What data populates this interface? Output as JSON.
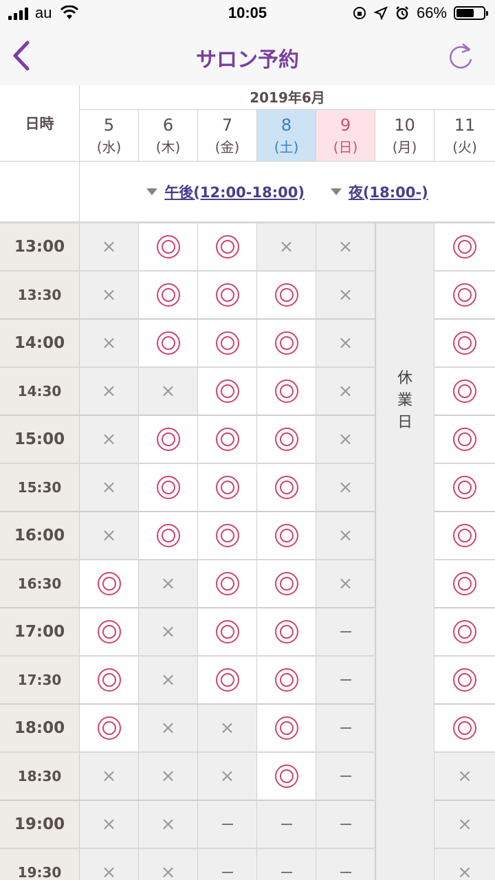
{
  "status": {
    "carrier": "au",
    "time": "10:05",
    "battery": "66%",
    "battery_level": 0.66
  },
  "nav": {
    "title": "サロン予約",
    "back_icon": "chevron-left-icon",
    "reload_icon": "reload-icon"
  },
  "header": {
    "datetime_label": "日時",
    "month": "2019年6月",
    "days": [
      {
        "num": "5",
        "dow": "(水)"
      },
      {
        "num": "6",
        "dow": "(木)"
      },
      {
        "num": "7",
        "dow": "(金)"
      },
      {
        "num": "8",
        "dow": "(土)"
      },
      {
        "num": "9",
        "dow": "(日)"
      },
      {
        "num": "10",
        "dow": "(月)"
      },
      {
        "num": "11",
        "dow": "(火)"
      }
    ],
    "filter_afternoon": "午後(12:00-18:00)",
    "filter_night": "夜(18:00-)"
  },
  "closed_label": "休業日",
  "colors": {
    "accent": "#7b3fa0",
    "ok_symbol": "#d0446a",
    "saturday_bg": "#cce3f5",
    "sunday_bg": "#fde3e8"
  },
  "slots": {
    "times": [
      "13:00",
      "13:30",
      "14:00",
      "14:30",
      "15:00",
      "15:30",
      "16:00",
      "16:30",
      "17:00",
      "17:30",
      "18:00",
      "18:30",
      "19:00",
      "19:30"
    ],
    "rows": [
      [
        "x",
        "o",
        "o",
        "x",
        "x",
        "o"
      ],
      [
        "x",
        "o",
        "o",
        "o",
        "x",
        "o"
      ],
      [
        "x",
        "o",
        "o",
        "o",
        "x",
        "o"
      ],
      [
        "x",
        "x",
        "o",
        "o",
        "x",
        "o"
      ],
      [
        "x",
        "o",
        "o",
        "o",
        "x",
        "o"
      ],
      [
        "x",
        "o",
        "o",
        "o",
        "x",
        "o"
      ],
      [
        "x",
        "o",
        "o",
        "o",
        "x",
        "o"
      ],
      [
        "o",
        "x",
        "o",
        "o",
        "x",
        "o"
      ],
      [
        "o",
        "x",
        "o",
        "o",
        "-",
        "o"
      ],
      [
        "o",
        "x",
        "o",
        "o",
        "-",
        "o"
      ],
      [
        "o",
        "x",
        "x",
        "o",
        "-",
        "o"
      ],
      [
        "x",
        "x",
        "x",
        "o",
        "-",
        "x"
      ],
      [
        "x",
        "x",
        "-",
        "-",
        "-",
        "x"
      ],
      [
        "x",
        "x",
        "-",
        "-",
        "-",
        "x"
      ]
    ]
  }
}
